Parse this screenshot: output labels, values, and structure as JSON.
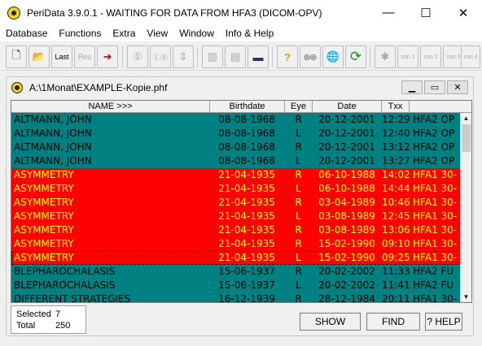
{
  "window": {
    "title": "PeriData 3.9.0.1 - WAITING FOR DATA FROM HFA3 (DICOM-OPV)",
    "minimize_glyph": "—",
    "maximize_glyph": "☐",
    "close_glyph": "✕"
  },
  "menu": {
    "items": [
      "Database",
      "Functions",
      "Extra",
      "View",
      "Window",
      "Info & Help"
    ]
  },
  "toolbar": {
    "buttons": [
      {
        "name": "new-file-icon",
        "glyph": "🗋",
        "label": ""
      },
      {
        "name": "open-folder-icon",
        "glyph": "📂",
        "label": ""
      },
      {
        "name": "last-button",
        "glyph": "",
        "label": "Last"
      },
      {
        "name": "res-button",
        "glyph": "",
        "label": "Res"
      },
      {
        "name": "import-icon",
        "glyph": "➜",
        "label": ""
      },
      {
        "name": "one-eye-icon",
        "glyph": "①",
        "label": ""
      },
      {
        "name": "both-eyes-icon",
        "glyph": "ⓁⓇ",
        "label": ""
      },
      {
        "name": "sort-icon",
        "glyph": "⇕",
        "label": ""
      },
      {
        "name": "split-vertical-icon",
        "glyph": "▥",
        "label": ""
      },
      {
        "name": "split-horizontal-icon",
        "glyph": "▤",
        "label": ""
      },
      {
        "name": "battery-icon",
        "glyph": "▬",
        "label": ""
      },
      {
        "name": "help-icon",
        "glyph": "?",
        "label": ""
      },
      {
        "name": "binoculars-icon",
        "glyph": "◎◎",
        "label": ""
      },
      {
        "name": "globe-icon",
        "glyph": "🌐",
        "label": ""
      },
      {
        "name": "refresh-icon",
        "glyph": "⟳",
        "label": ""
      },
      {
        "name": "device-icon",
        "glyph": "✱",
        "label": ""
      },
      {
        "name": "com1-icon",
        "glyph": "",
        "label": "con 1"
      },
      {
        "name": "com2-icon",
        "glyph": "",
        "label": "con 2"
      },
      {
        "name": "com3-icon",
        "glyph": "",
        "label": "con 3"
      },
      {
        "name": "com4-icon",
        "glyph": "",
        "label": "con 4"
      }
    ]
  },
  "document": {
    "path": "A:\\1Monat\\EXAMPLE-Kopie.phf",
    "columns": [
      "NAME >>>",
      "Birthdate",
      "Eye",
      "Date",
      "Txx"
    ],
    "rows": [
      {
        "name": "ALTMANN, JOHN",
        "birthdate": "08-08-1968",
        "eye": "R",
        "date": "20-12-2001",
        "time": "12:29",
        "device": "HFA2  OP",
        "style": "normal"
      },
      {
        "name": "ALTMANN, JOHN",
        "birthdate": "08-08-1968",
        "eye": "L",
        "date": "20-12-2001",
        "time": "12:40",
        "device": "HFA2  OP",
        "style": "normal"
      },
      {
        "name": "ALTMANN, JOHN",
        "birthdate": "08-08-1968",
        "eye": "R",
        "date": "20-12-2001",
        "time": "13:12",
        "device": "HFA2  OP",
        "style": "normal"
      },
      {
        "name": "ALTMANN, JOHN",
        "birthdate": "08-08-1968",
        "eye": "L",
        "date": "20-12-2001",
        "time": "13:27",
        "device": "HFA2  OP",
        "style": "normal"
      },
      {
        "name": "ASYMMETRY",
        "birthdate": "21-04-1935",
        "eye": "R",
        "date": "06-10-1988",
        "time": "14:02",
        "device": "HFA1  30-",
        "style": "red"
      },
      {
        "name": "ASYMMETRY",
        "birthdate": "21-04-1935",
        "eye": "L",
        "date": "06-10-1988",
        "time": "14:44",
        "device": "HFA1  30-",
        "style": "red"
      },
      {
        "name": "ASYMMETRY",
        "birthdate": "21-04-1935",
        "eye": "R",
        "date": "03-04-1989",
        "time": "10:46",
        "device": "HFA1  30-",
        "style": "red"
      },
      {
        "name": "ASYMMETRY",
        "birthdate": "21-04-1935",
        "eye": "L",
        "date": "03-08-1989",
        "time": "12:45",
        "device": "HFA1  30-",
        "style": "red"
      },
      {
        "name": "ASYMMETRY",
        "birthdate": "21-04-1935",
        "eye": "R",
        "date": "03-08-1989",
        "time": "13:06",
        "device": "HFA1  30-",
        "style": "red"
      },
      {
        "name": "ASYMMETRY",
        "birthdate": "21-04-1935",
        "eye": "R",
        "date": "15-02-1990",
        "time": "09:10",
        "device": "HFA1  30-",
        "style": "red"
      },
      {
        "name": "ASYMMETRY",
        "birthdate": "21-04-1935",
        "eye": "L",
        "date": "15-02-1990",
        "time": "09:25",
        "device": "HFA1  30-",
        "style": "red focused"
      },
      {
        "name": "BLEPHAROCHALASIS",
        "birthdate": "15-06-1937",
        "eye": "R",
        "date": "20-02-2002",
        "time": "11:33",
        "device": "HFA2  FU",
        "style": "normal"
      },
      {
        "name": "BLEPHAROCHALASIS",
        "birthdate": "15-06-1937",
        "eye": "L",
        "date": "20-02-2002",
        "time": "11:41",
        "device": "HFA2  FU",
        "style": "normal"
      },
      {
        "name": "DIFFERENT STRATEGIES",
        "birthdate": "16-12-1939",
        "eye": "R",
        "date": "28-12-1984",
        "time": "20:11",
        "device": "HFA1  30-",
        "style": "normal"
      }
    ]
  },
  "stats": {
    "selected_label": "Selected",
    "selected_value": "7",
    "total_label": "Total",
    "total_value": "250"
  },
  "actions": {
    "show": "SHOW",
    "find": "FIND",
    "help": "? HELP"
  },
  "colors": {
    "row_normal_bg": "#008080",
    "row_selected_bg": "#ff0000",
    "row_selected_fg": "#ffff00"
  }
}
